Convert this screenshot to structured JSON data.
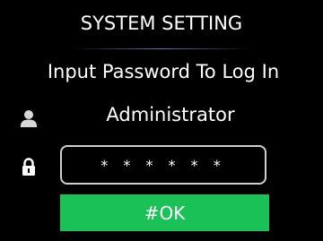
{
  "header": {
    "title": "SYSTEM SETTING"
  },
  "login": {
    "prompt": "Input Password To Log In",
    "user_icon": "user-icon",
    "lock_icon": "lock-icon",
    "username": "Administrator",
    "password_value": "* * * * * *",
    "ok_label": "#OK"
  },
  "colors": {
    "background": "#000000",
    "text": "#ffffff",
    "field_border": "#cfcfcf",
    "ok_button": "#19c157",
    "divider": "#648cc8"
  }
}
